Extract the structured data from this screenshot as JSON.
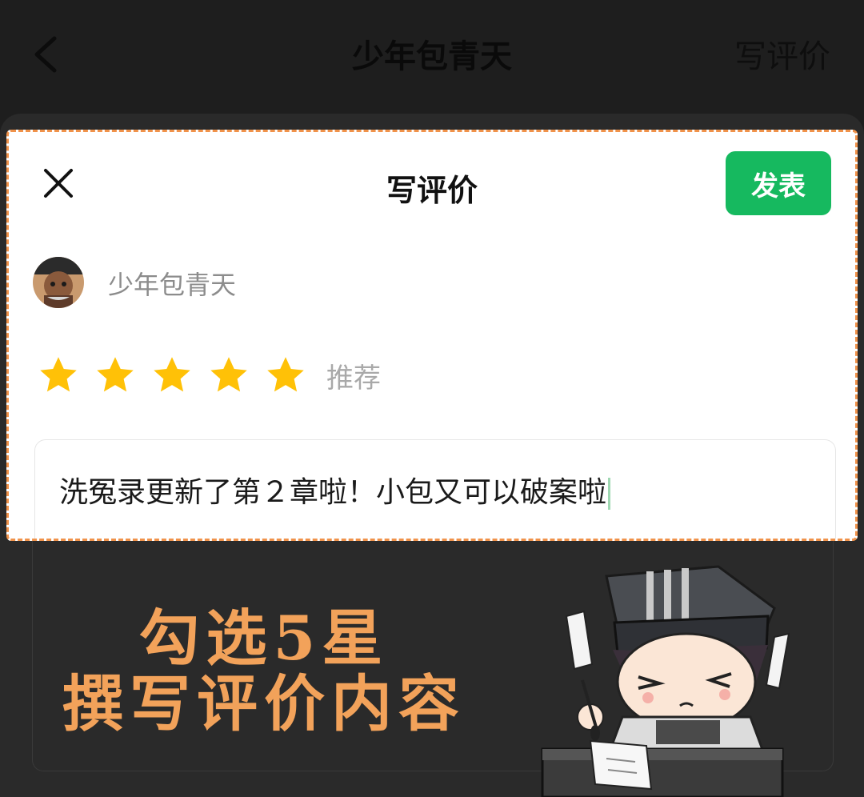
{
  "topbar": {
    "title": "少年包青天",
    "action_label": "写评价"
  },
  "modal": {
    "title": "写评价",
    "publish_label": "发表",
    "book_name": "少年包青天",
    "rating": {
      "stars": 5,
      "max": 5,
      "label": "推荐"
    },
    "review_text": "洗冤录更新了第２章啦！小包又可以破案啦"
  },
  "overlay": {
    "line1": "勾选5星",
    "line2": "撰写评价内容"
  },
  "colors": {
    "accent": "#16b95f",
    "star": "#ffc107",
    "overlay_text": "#f2a25a",
    "dashed_border": "#f0924a"
  },
  "icons": {
    "back": "chevron-left-icon",
    "close": "close-icon",
    "star": "star-icon"
  }
}
